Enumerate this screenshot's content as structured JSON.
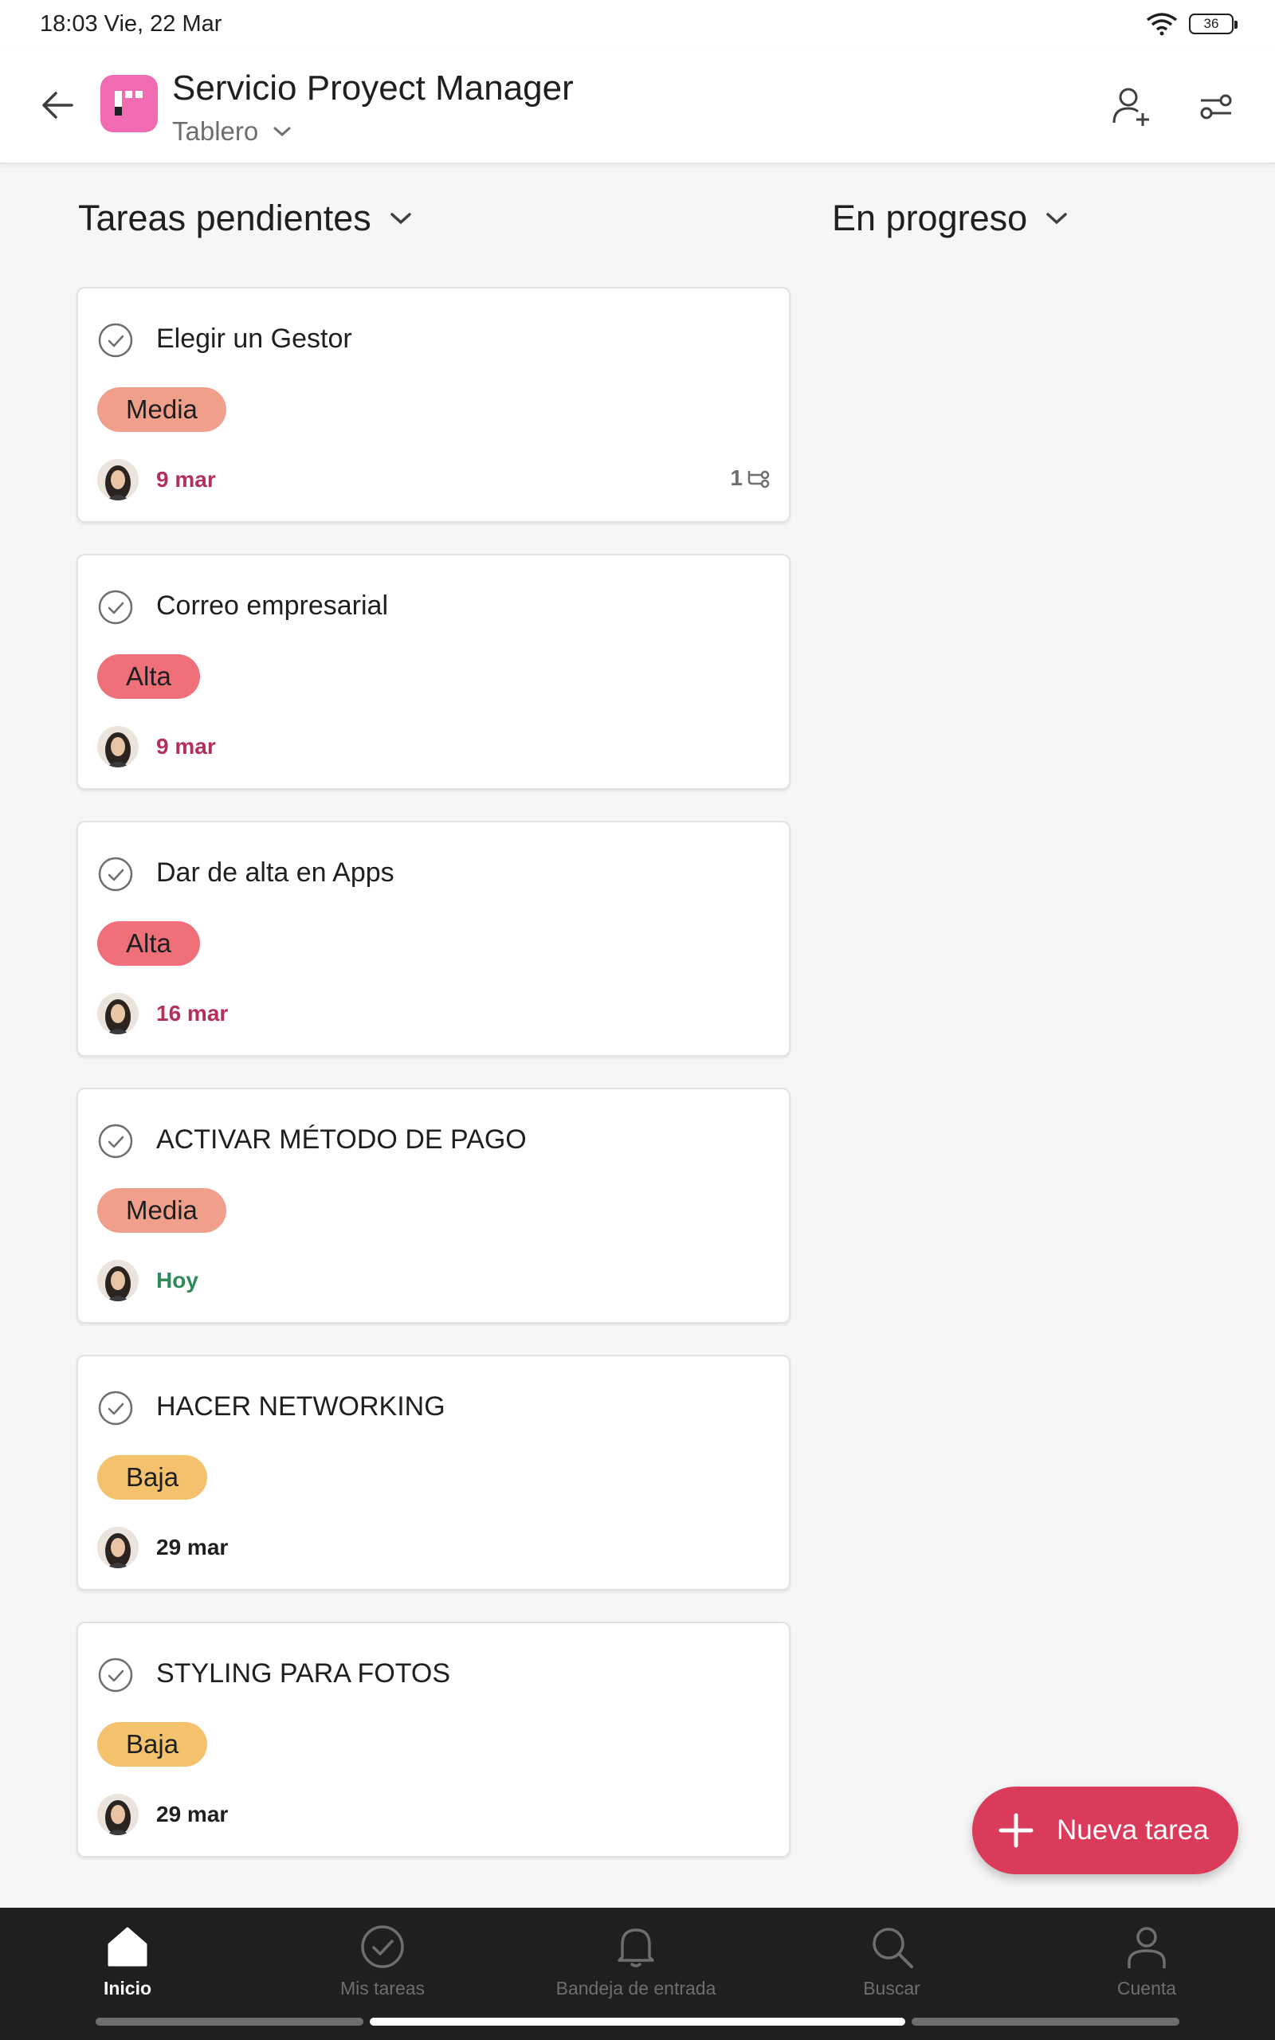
{
  "status_bar": {
    "time": "18:03 Vie, 22 Mar",
    "battery": "36"
  },
  "header": {
    "project_name": "Servicio Proyect Manager",
    "view": "Tablero"
  },
  "columns": [
    {
      "title": "Tareas pendientes"
    },
    {
      "title": "En progreso"
    }
  ],
  "tasks": [
    {
      "name": "Elegir un Gestor",
      "priority": "Media",
      "priority_color": "#f0a08a",
      "due": "9 mar",
      "due_color": "#b52f5d",
      "subtasks": "1"
    },
    {
      "name": "Correo empresarial",
      "priority": "Alta",
      "priority_color": "#f07079",
      "due": "9 mar",
      "due_color": "#b52f5d"
    },
    {
      "name": "Dar de alta en Apps",
      "priority": "Alta",
      "priority_color": "#f07079",
      "due": "16 mar",
      "due_color": "#b52f5d"
    },
    {
      "name": "ACTIVAR MÉTODO DE PAGO",
      "priority": "Media",
      "priority_color": "#f0a08a",
      "due": "Hoy",
      "due_color": "#2e8a57"
    },
    {
      "name": "HACER NETWORKING",
      "priority": "Baja",
      "priority_color": "#f4c26d",
      "due": "29 mar",
      "due_color": "#1e1f21"
    },
    {
      "name": "STYLING PARA FOTOS",
      "priority": "Baja",
      "priority_color": "#f4c26d",
      "due": "29 mar",
      "due_color": "#1e1f21"
    }
  ],
  "fab": {
    "label": "Nueva tarea"
  },
  "bottom_nav": [
    {
      "label": "Inicio",
      "icon": "home-icon",
      "active": true
    },
    {
      "label": "Mis tareas",
      "icon": "check-circle-icon"
    },
    {
      "label": "Bandeja de entrada",
      "icon": "bell-icon"
    },
    {
      "label": "Buscar",
      "icon": "search-icon"
    },
    {
      "label": "Cuenta",
      "icon": "person-icon"
    }
  ]
}
